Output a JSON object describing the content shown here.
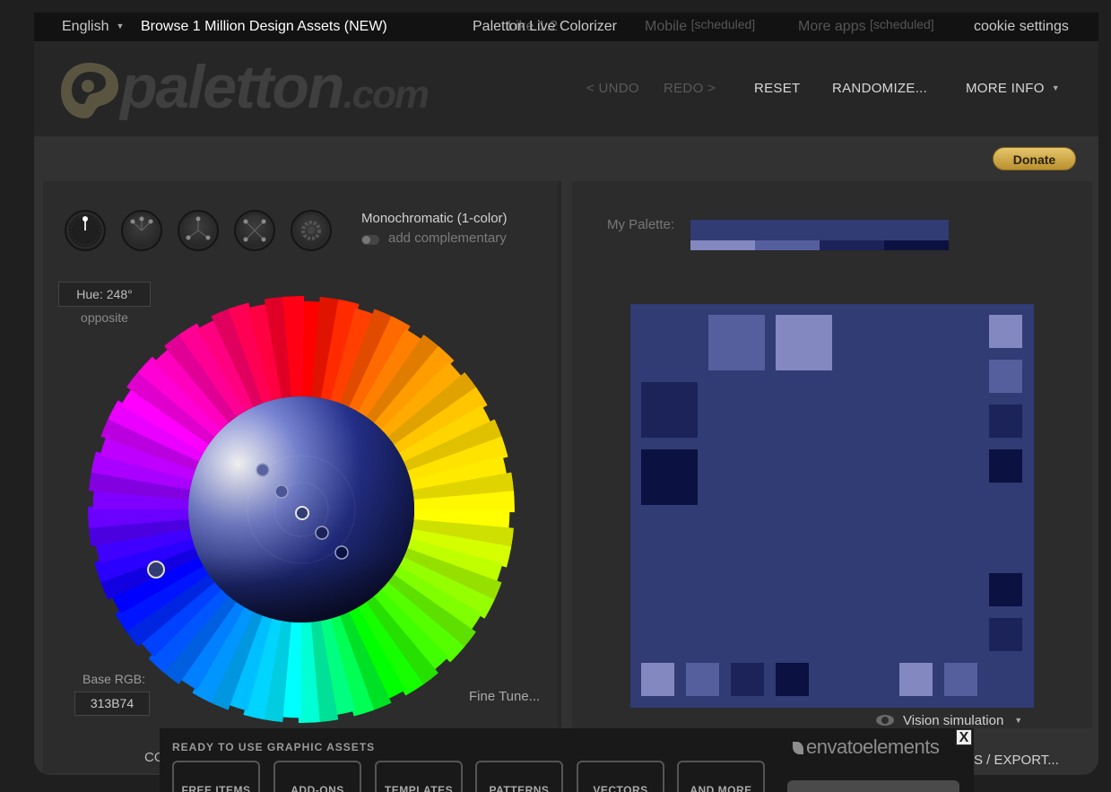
{
  "topbar": {
    "language": "English",
    "promo": "Browse 1 Million Design Assets (NEW)",
    "live_colorizer": "Paletton Live Colorizer",
    "like_count": "Like 1.2",
    "mobile": "Mobile",
    "mobile_status": "[scheduled]",
    "more_apps": "More apps",
    "more_apps_status": "[scheduled]",
    "cookie": "cookie settings"
  },
  "header": {
    "logo_text": "paletton",
    "logo_suffix": ".com",
    "undo": "< UNDO",
    "redo": "REDO >",
    "reset": "RESET",
    "randomize": "RANDOMIZE...",
    "more_info": "MORE INFO"
  },
  "donate": "Donate",
  "color_panel": {
    "mode_title": "Monochromatic (1-color)",
    "add_complementary": "add complementary",
    "hue": "Hue: 248°",
    "opposite": "opposite",
    "base_rgb_label": "Base RGB:",
    "base_rgb": "313B74",
    "fine_tune": "Fine Tune...",
    "modes": [
      "mono",
      "adjacent",
      "triad",
      "tetrad",
      "free"
    ]
  },
  "palette_panel": {
    "my_palette_label": "My Palette:",
    "base_color": "#313b74",
    "shades": [
      "#8389c0",
      "#565f9d",
      "#1b2359",
      "#0b1140"
    ],
    "vision_simulation": "Vision simulation"
  },
  "bottom": {
    "left_label": "CO",
    "right_label": "ES / EXPORT..."
  },
  "ad": {
    "title": "READY TO USE GRAPHIC ASSETS",
    "brand": "envatoelements",
    "buttons": [
      "FREE ITEMS",
      "ADD-ONS",
      "TEMPLATES",
      "PATTERNS",
      "VECTORS",
      "AND MORE"
    ],
    "close": "X"
  }
}
